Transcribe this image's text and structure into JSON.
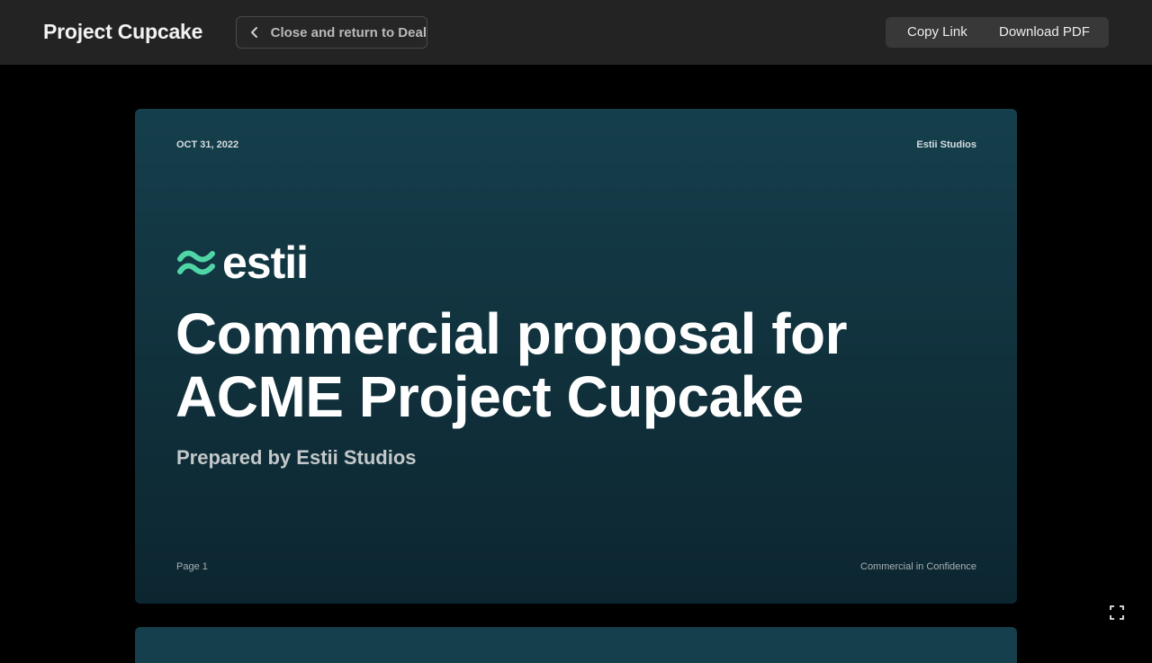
{
  "header": {
    "title": "Project Cupcake",
    "back_button_label": "Close and return to Deal",
    "copy_link_label": "Copy Link",
    "download_pdf_label": "Download PDF",
    "back_icon": "chevron-left-icon"
  },
  "slide": {
    "date": "OCT 31, 2022",
    "company": "Estii Studios",
    "logo_text": "estii",
    "logo_icon": "estii-wave-logo-icon",
    "headline_line1": "Commercial proposal for",
    "headline_line2": "ACME Project Cupcake",
    "prepared_by": "Prepared by Estii Studios",
    "page_label": "Page 1",
    "confidential_label": "Commercial in Confidence"
  },
  "controls": {
    "fullscreen_icon": "fullscreen-icon"
  },
  "colors": {
    "topbar_bg": "#232323",
    "slide_bg": "#153f4c",
    "logo_mark": "#4fd6a6"
  }
}
